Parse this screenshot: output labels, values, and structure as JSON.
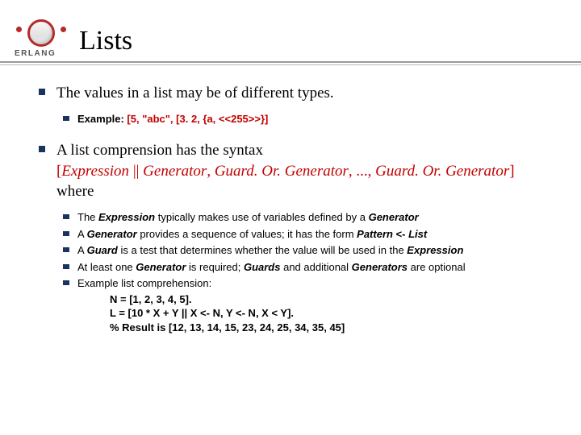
{
  "logoBrand": "ERLANG",
  "title": "Lists",
  "bullets": {
    "b1": {
      "text": "The values in a list may be of different types.",
      "sub": {
        "label": "Example: ",
        "code": "[5, \"abc\", [3. 2, {a, <<255>>}]"
      }
    },
    "b2": {
      "line1a": "A list comprension has the syntax",
      "line2a": "[",
      "line2_expr": "Expression",
      "line2_sep": " || ",
      "line2_gen": "Generator",
      "line2_comma1": ", ",
      "line2_gog1": "Guard. Or. Generator",
      "line2_comma2": ", ..., ",
      "line2_gog2": "Guard. Or. Generator",
      "line2b": "]",
      "line3": "where",
      "sub": [
        {
          "pre": "The ",
          "b1": "Expression",
          "mid1": " typically makes use of variables defined by a ",
          "b2": "Generator",
          "post": ""
        },
        {
          "pre": "A ",
          "b1": "Generator",
          "mid1": " provides a sequence of values; it has the form ",
          "b2": "Pattern",
          "mid2": " <- ",
          "b3": "List",
          "post": ""
        },
        {
          "pre": "A ",
          "b1": "Guard",
          "mid1": " is a test that determines whether the value will be used in the ",
          "b2": "Expression",
          "post": ""
        },
        {
          "pre": "At least one ",
          "b1": "Generator",
          "mid1": " is required; ",
          "b2": "Guards",
          "mid2": " and additional ",
          "b3": "Generators",
          "post": " are optional"
        },
        {
          "pre": "Example list comprehension:"
        }
      ],
      "code": {
        "l1": "N = [1, 2, 3, 4, 5].",
        "l2": "L = [10 * X + Y || X <- N, Y <- N, X < Y].",
        "l3": "% Result is [12, 13, 14, 15, 23, 24, 25, 34, 35, 45]"
      }
    }
  }
}
